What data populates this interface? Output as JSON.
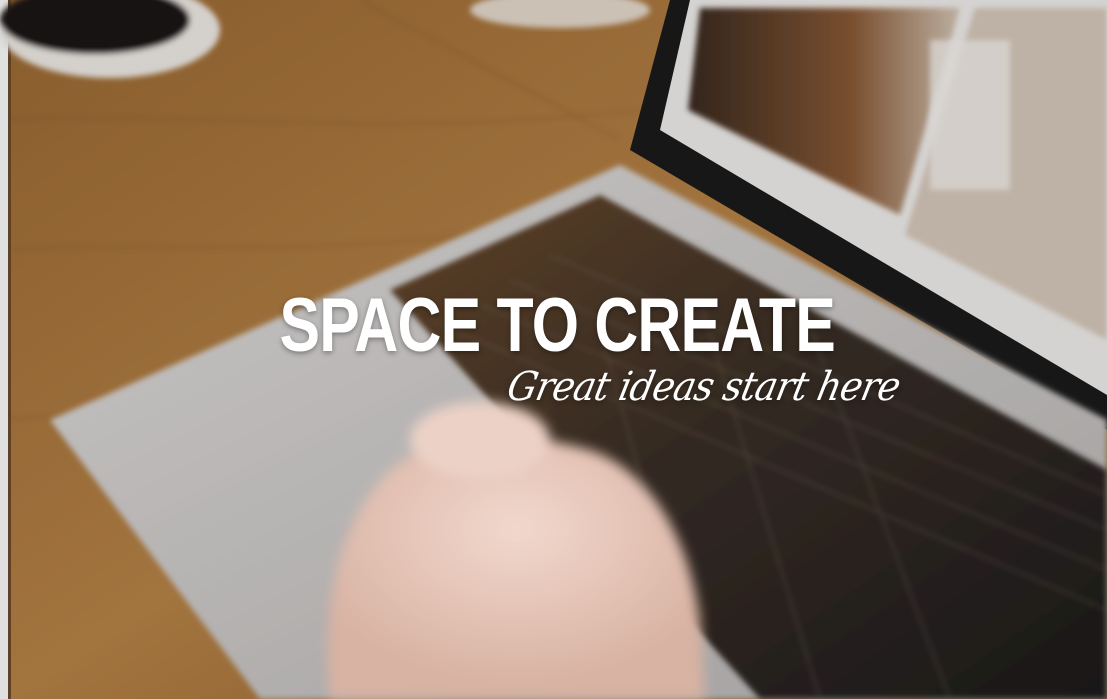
{
  "hero": {
    "title": "SPACE TO CREATE",
    "tagline": "Great ideas start here"
  },
  "colors": {
    "text": "#ffffff",
    "wood": "#b07a3f",
    "laptop": "#c9c7c7",
    "keys": "#2a2623"
  }
}
